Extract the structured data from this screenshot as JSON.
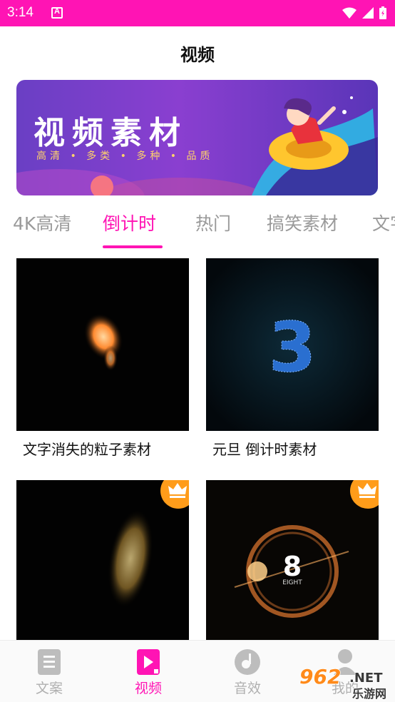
{
  "status_bar": {
    "time": "3:14"
  },
  "header": {
    "title": "视频"
  },
  "banner": {
    "title": "视频素材",
    "subtitle": "高清 • 多类 • 多种 • 品质"
  },
  "tabs": [
    {
      "label": "4K高清"
    },
    {
      "label": "倒计时"
    },
    {
      "label": "热门"
    },
    {
      "label": "搞笑素材"
    },
    {
      "label": "文字"
    }
  ],
  "cards": [
    {
      "title": "文字消失的粒子素材",
      "premium": false
    },
    {
      "title": "元旦 倒计时素材",
      "premium": false
    },
    {
      "title": "",
      "premium": true
    },
    {
      "title": "",
      "premium": true
    }
  ],
  "thumb_texts": {
    "countdown_digit": "3",
    "eight_digit": "8",
    "eight_word": "EIGHT"
  },
  "bottom_nav": [
    {
      "label": "文案",
      "icon": "document-icon"
    },
    {
      "label": "视频",
      "icon": "video-play-icon"
    },
    {
      "label": "音效",
      "icon": "music-disc-icon"
    },
    {
      "label": "我的",
      "icon": "user-icon"
    }
  ],
  "watermark": {
    "number": "962",
    "suffix": ".NET",
    "text": "乐游网"
  },
  "colors": {
    "accent": "#ff14b4",
    "inactive": "#9a9a9a",
    "crown_badge": "#ff9c1a"
  }
}
